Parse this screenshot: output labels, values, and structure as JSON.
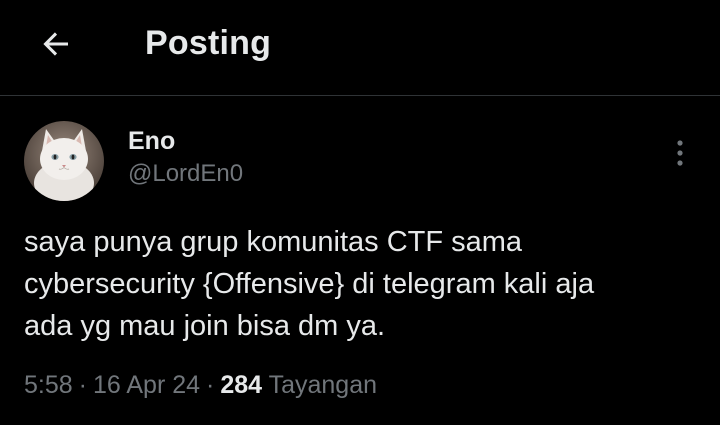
{
  "header": {
    "back_icon": "arrow-left-icon",
    "title": "Posting"
  },
  "post": {
    "avatar_icon": "white-cat-avatar",
    "display_name": "Eno",
    "handle": "@LordEn0",
    "more_icon": "vertical-ellipsis-icon",
    "text": "saya punya grup komunitas CTF sama\ncybersecurity {Offensive} di telegram kali aja\nada yg mau join bisa dm ya.",
    "time": "5:58",
    "separator": "·",
    "date": "16 Apr 24",
    "views_count": "284",
    "views_label": "Tayangan"
  },
  "colors": {
    "background": "#000000",
    "primary_text": "#e7e9ea",
    "secondary_text": "#71767b",
    "divider": "#2f3336"
  }
}
